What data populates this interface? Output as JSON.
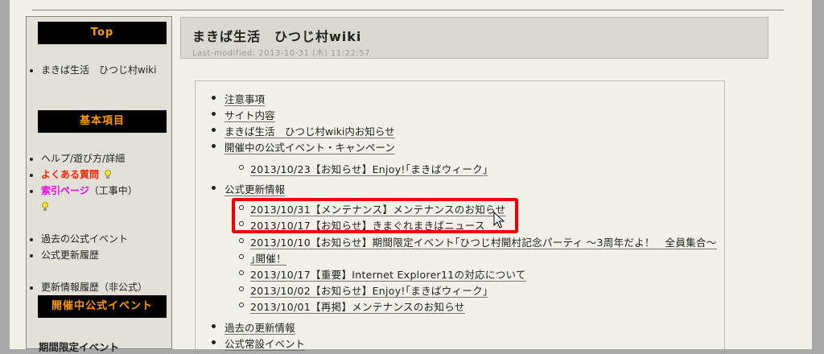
{
  "sidebar": {
    "sections": [
      {
        "heading": "Top"
      },
      {
        "heading": "基本項目"
      },
      {
        "heading": "開催中公式イベント"
      }
    ],
    "top_items": [
      {
        "label": "まきば生活　ひつじ村wiki"
      }
    ],
    "basic_items": [
      {
        "label": "ヘルプ/遊び方/詳細"
      },
      {
        "label": "よくある質問"
      },
      {
        "label": "索引ページ"
      },
      {
        "label": "（工事中）"
      }
    ],
    "extra_items": [
      {
        "label": "過去の公式イベント"
      },
      {
        "label": "公式更新履歴"
      }
    ],
    "history_item": {
      "label": "更新情報履歴（非公式）"
    },
    "event_text": "期間限定イベント"
  },
  "header": {
    "title": "まきば生活　ひつじ村wiki",
    "last_modified": "Last-modified: 2013-10-31 (木) 11:22:57"
  },
  "content": {
    "top_items": [
      {
        "label": "注意事項"
      },
      {
        "label": "サイト内容"
      },
      {
        "label": "まきば生活　ひつじ村wiki内お知らせ"
      },
      {
        "label": "開催中の公式イベント・キャンペーン"
      }
    ],
    "event_items": [
      {
        "label": "2013/10/23【お知らせ】Enjoy!｢まきばウィーク｣"
      }
    ],
    "official_update_label": "公式更新情報",
    "update_items": [
      {
        "label": "2013/10/31【メンテナンス】メンテナンスのお知らせ"
      },
      {
        "label": "2013/10/17【お知らせ】きまぐれまきばニュース"
      },
      {
        "label": "2013/10/10【お知らせ】期間限定イベント｢ひつじ村開村記念パーティ ～3周年だよ！　全員集合～"
      },
      {
        "label": "｣開催！"
      },
      {
        "label": "2013/10/17【重要】Internet Explorer11の対応について"
      },
      {
        "label": "2013/10/02【お知らせ】Enjoy!｢まきばウィーク｣"
      },
      {
        "label": "2013/10/01【再掲】メンテナンスのお知らせ"
      }
    ],
    "bottom_items": [
      {
        "label": "過去の更新情報"
      },
      {
        "label": "公式常設イベント"
      }
    ]
  },
  "colors": {
    "sidebar_heading_bg": "#000000",
    "sidebar_heading_text": "#ff9900",
    "faq_link": "#ff2200",
    "index_link": "#ee00ee",
    "highlight_box": "#ee0000"
  }
}
